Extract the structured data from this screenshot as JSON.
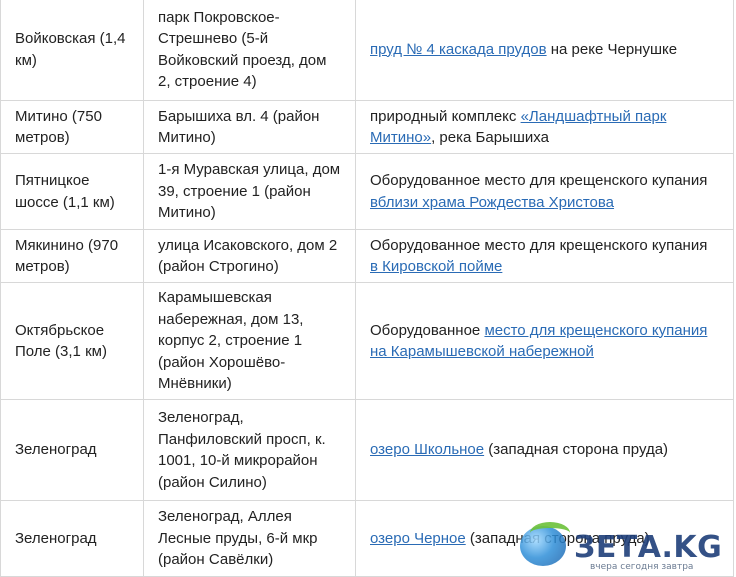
{
  "rows": [
    {
      "station": "Войковская (1,4 км)",
      "address": "парк Покровское-Стрешнево (5-й Войковский проезд, дом 2, строение 4)",
      "place": {
        "pre": "",
        "link": "пруд № 4 каскада прудов",
        "post": " на реке Чернушке"
      }
    },
    {
      "station": "Митино (750 метров)",
      "address": "Барышиха вл. 4 (район Митино)",
      "place": {
        "pre": "природный комплекс ",
        "link": "«Ландшафтный парк Митино»",
        "post": ", река Барышиха"
      }
    },
    {
      "station": "Пятницкое шоссе (1,1 км)",
      "address": "1-я Муравская улица, дом 39, строение 1 (район Митино)",
      "place": {
        "pre": "Оборудованное место для крещенского купания ",
        "link": "вблизи храма Рождества Христова",
        "post": ""
      }
    },
    {
      "station": "Мякинино (970 метров)",
      "address": "улица Исаковского, дом 2 (район Строгино)",
      "place": {
        "pre": "Оборудованное место для крещенского купания ",
        "link": "в Кировской пойме",
        "post": ""
      }
    },
    {
      "station": "Октябрьское Поле (3,1 км)",
      "address": "Карамышевская набережная, дом 13, корпус 2, строение 1 (район Хорошёво-Мнёвники)",
      "place": {
        "pre": "Оборудованное ",
        "link": "место для крещенского купания на Карамышевской набережной",
        "post": ""
      }
    },
    {
      "station": "Зеленоград",
      "address": "Зеленоград, Панфиловский просп, к. 1001, 10-й микрорайон (район Силино)",
      "place": {
        "pre": "",
        "link": "озеро Школьное",
        "post": " (западная сторона пруда)"
      }
    },
    {
      "station": "Зеленоград",
      "address": "Зеленоград, Аллея Лесные пруды, 6-й мкр (район Савёлки)",
      "place": {
        "pre": "",
        "link": "озеро Черное",
        "post": " (западная сторона пруда)"
      }
    }
  ],
  "watermark": {
    "logo": "ЗЕТА.KG",
    "tagline": "вчера сегодня завтра"
  },
  "colors": {
    "link": "#2a6bb5",
    "border": "#d8d8d8"
  }
}
